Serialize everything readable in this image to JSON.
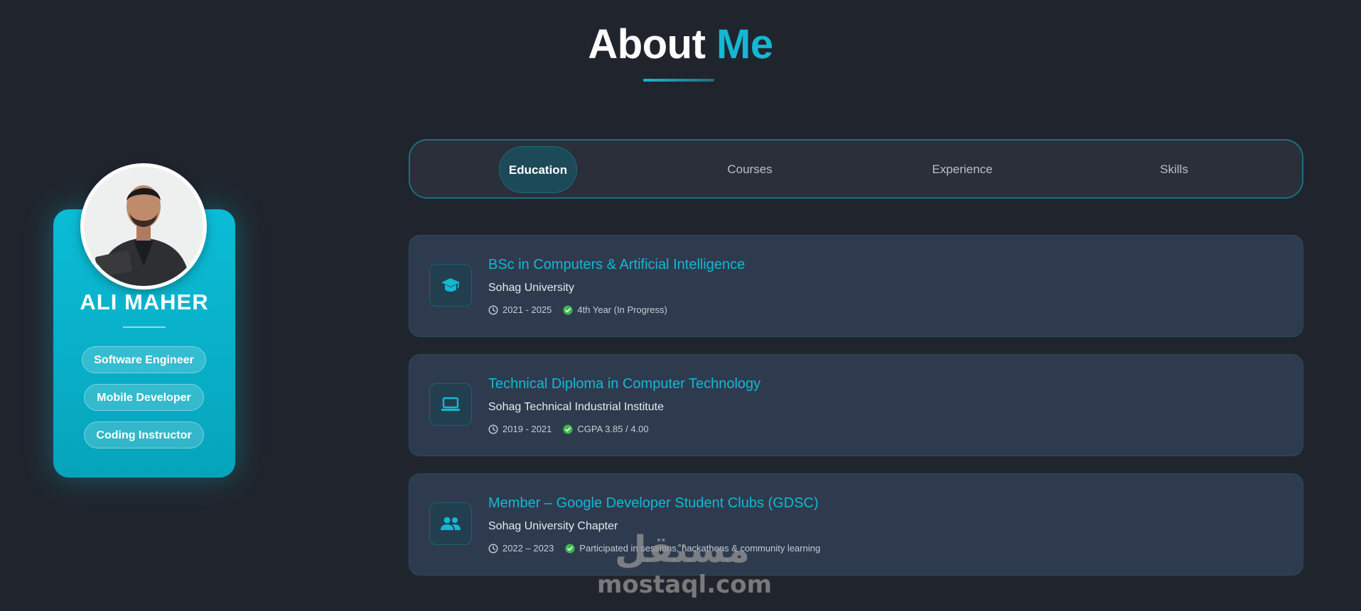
{
  "header": {
    "title_part1": "About",
    "title_part2": "Me"
  },
  "profile": {
    "name": "ALI MAHER",
    "roles": [
      "Software Engineer",
      "Mobile Developer",
      "Coding Instructor"
    ],
    "accent_color": "#0bbcd6"
  },
  "tabs": [
    {
      "label": "Education",
      "active": true
    },
    {
      "label": "Courses",
      "active": false
    },
    {
      "label": "Experience",
      "active": false
    },
    {
      "label": "Skills",
      "active": false
    }
  ],
  "education": [
    {
      "icon": "graduation-cap-icon",
      "title": "BSc in Computers & Artificial Intelligence",
      "institution": "Sohag University",
      "period": "2021 - 2025",
      "status": "4th Year (In Progress)"
    },
    {
      "icon": "laptop-icon",
      "title": "Technical Diploma in Computer Technology",
      "institution": "Sohag Technical Industrial Institute",
      "period": "2019 - 2021",
      "status": "CGPA 3.85 / 4.00"
    },
    {
      "icon": "people-icon",
      "title": "Member – Google Developer Student Clubs (GDSC)",
      "institution": "Sohag University Chapter",
      "period": "2022 – 2023",
      "status": "Participated in sessions, hackathons & community learning"
    }
  ],
  "watermark": {
    "arabic": "مستقل",
    "latin": "mostaql.com"
  },
  "colors": {
    "background": "#20252d",
    "accent": "#13b8d2",
    "card": "#2e3b4e",
    "check": "#3fb950"
  }
}
